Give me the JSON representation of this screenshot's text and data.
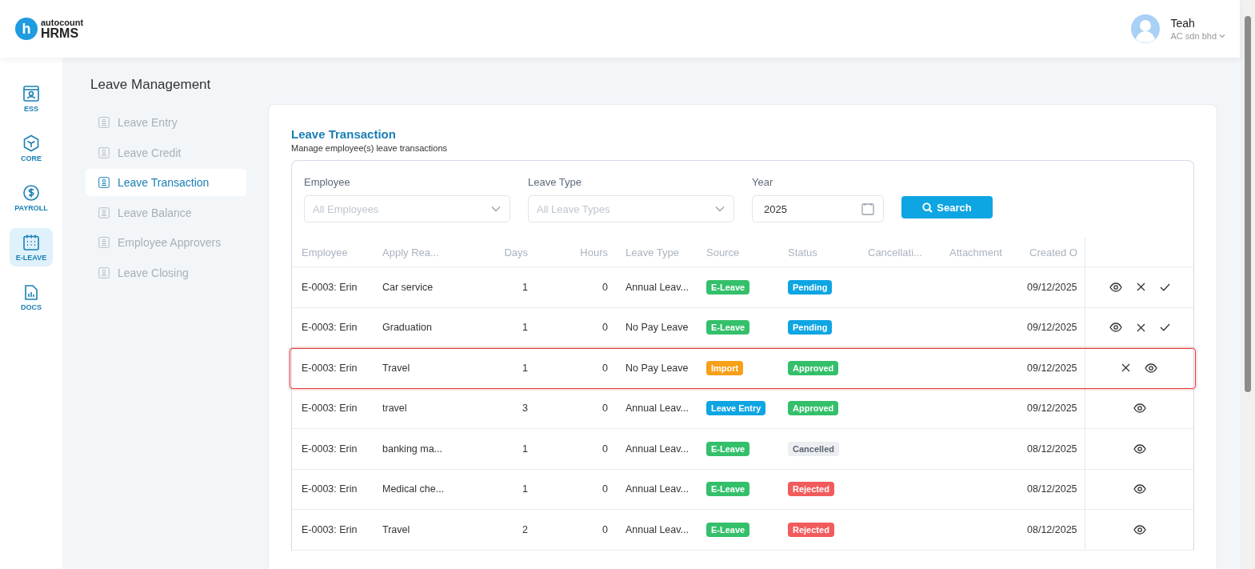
{
  "header": {
    "logo_mark": "h",
    "logo_top": "autocount",
    "logo_bottom": "HRMS",
    "user": {
      "name": "Teah",
      "company": "AC sdn bhd"
    }
  },
  "rail": [
    {
      "label": "ESS",
      "kind": "ess",
      "selected": false
    },
    {
      "label": "CORE",
      "kind": "core",
      "selected": false
    },
    {
      "label": "PAYROLL",
      "kind": "payroll",
      "selected": false
    },
    {
      "label": "E-LEAVE",
      "kind": "eleave",
      "selected": true
    },
    {
      "label": "DOCS",
      "kind": "docs",
      "selected": false
    }
  ],
  "submenu": {
    "title": "Leave Management",
    "items": [
      {
        "label": "Leave Entry",
        "selected": false
      },
      {
        "label": "Leave Credit",
        "selected": false
      },
      {
        "label": "Leave Transaction",
        "selected": true
      },
      {
        "label": "Leave Balance",
        "selected": false
      },
      {
        "label": "Employee Approvers",
        "selected": false
      },
      {
        "label": "Leave Closing",
        "selected": false
      }
    ]
  },
  "page": {
    "title": "Leave Transaction",
    "subtitle": "Manage employee(s) leave transactions"
  },
  "filters": {
    "employee": {
      "label": "Employee",
      "placeholder": "All Employees"
    },
    "leave_type": {
      "label": "Leave Type",
      "placeholder": "All Leave Types"
    },
    "year": {
      "label": "Year",
      "value": "2025"
    },
    "search_button": "Search"
  },
  "table": {
    "columns": [
      "Employee",
      "Apply Rea...",
      "Days",
      "Hours",
      "Leave Type",
      "Source",
      "Status",
      "Cancellati...",
      "Attachment",
      "Created O"
    ],
    "rows": [
      {
        "employee": "E-0003: Erin",
        "reason": "Car service",
        "days": "1",
        "hours": "0",
        "leave_type": "Annual Leav...",
        "source": {
          "label": "E-Leave",
          "kind": "eleave"
        },
        "status": {
          "label": "Pending",
          "kind": "pending"
        },
        "created": "09/12/2025",
        "actions": [
          {
            "kind": "view"
          },
          {
            "kind": "reject"
          },
          {
            "kind": "approve"
          }
        ],
        "highlighted": false
      },
      {
        "employee": "E-0003: Erin",
        "reason": "Graduation",
        "days": "1",
        "hours": "0",
        "leave_type": "No Pay Leave",
        "source": {
          "label": "E-Leave",
          "kind": "eleave"
        },
        "status": {
          "label": "Pending",
          "kind": "pending"
        },
        "created": "09/12/2025",
        "actions": [
          {
            "kind": "view"
          },
          {
            "kind": "reject"
          },
          {
            "kind": "approve"
          }
        ],
        "highlighted": false
      },
      {
        "employee": "E-0003: Erin",
        "reason": "Travel",
        "days": "1",
        "hours": "0",
        "leave_type": "No Pay Leave",
        "source": {
          "label": "Import",
          "kind": "import"
        },
        "status": {
          "label": "Approved",
          "kind": "approved"
        },
        "created": "09/12/2025",
        "actions": [
          {
            "kind": "reject"
          },
          {
            "kind": "view"
          }
        ],
        "highlighted": true
      },
      {
        "employee": "E-0003: Erin",
        "reason": "travel",
        "days": "3",
        "hours": "0",
        "leave_type": "Annual Leav...",
        "source": {
          "label": "Leave Entry",
          "kind": "entry"
        },
        "status": {
          "label": "Approved",
          "kind": "approved"
        },
        "created": "09/12/2025",
        "actions": [
          {
            "kind": "view"
          }
        ],
        "highlighted": false
      },
      {
        "employee": "E-0003: Erin",
        "reason": "banking ma...",
        "days": "1",
        "hours": "0",
        "leave_type": "Annual Leav...",
        "source": {
          "label": "E-Leave",
          "kind": "eleave"
        },
        "status": {
          "label": "Cancelled",
          "kind": "cancelled"
        },
        "created": "08/12/2025",
        "actions": [
          {
            "kind": "view"
          }
        ],
        "highlighted": false
      },
      {
        "employee": "E-0003: Erin",
        "reason": "Medical che...",
        "days": "1",
        "hours": "0",
        "leave_type": "Annual Leav...",
        "source": {
          "label": "E-Leave",
          "kind": "eleave"
        },
        "status": {
          "label": "Rejected",
          "kind": "rejected"
        },
        "created": "08/12/2025",
        "actions": [
          {
            "kind": "view"
          }
        ],
        "highlighted": false
      },
      {
        "employee": "E-0003: Erin",
        "reason": "Travel",
        "days": "2",
        "hours": "0",
        "leave_type": "Annual Leav...",
        "source": {
          "label": "E-Leave",
          "kind": "eleave"
        },
        "status": {
          "label": "Rejected",
          "kind": "rejected"
        },
        "created": "08/12/2025",
        "actions": [
          {
            "kind": "view"
          }
        ],
        "highlighted": false
      }
    ]
  }
}
